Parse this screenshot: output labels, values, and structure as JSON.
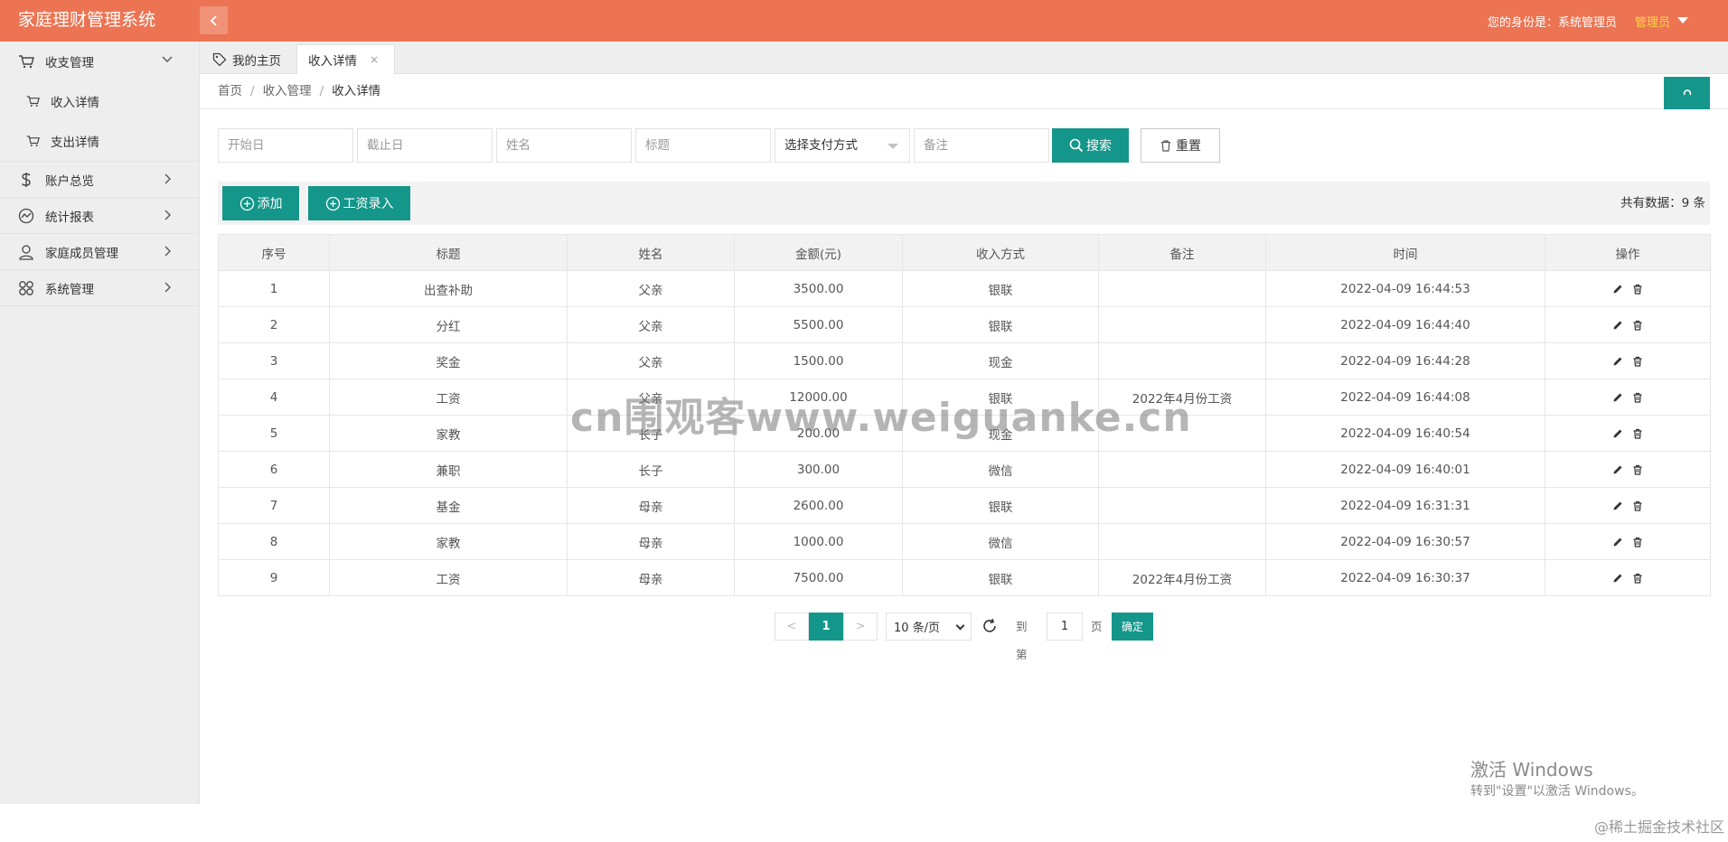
{
  "header": {
    "app_title": "家庭理财管理系统",
    "identity_text": "您的身份是：系统管理员",
    "user_label": "管理员"
  },
  "sidebar": {
    "groups": [
      {
        "label": "收支管理",
        "icon": "cart-icon",
        "expanded": true,
        "children": [
          {
            "label": "收入详情",
            "icon": "cart-icon"
          },
          {
            "label": "支出详情",
            "icon": "cart-icon"
          }
        ]
      },
      {
        "label": "账户总览",
        "icon": "dollar-icon"
      },
      {
        "label": "统计报表",
        "icon": "chart-icon"
      },
      {
        "label": "家庭成员管理",
        "icon": "user-icon"
      },
      {
        "label": "系统管理",
        "icon": "apps-icon"
      }
    ]
  },
  "tabs": [
    {
      "label": "我的主页",
      "icon": "tag-icon"
    },
    {
      "label": "收入详情",
      "close": "×",
      "active": true
    }
  ],
  "breadcrumb": [
    "首页",
    "收入管理",
    "收入详情"
  ],
  "breadcrumb_sep": "/",
  "search": {
    "start_placeholder": "开始日",
    "end_placeholder": "截止日",
    "name_placeholder": "姓名",
    "title_placeholder": "标题",
    "pay_method_value": "选择支付方式",
    "remark_placeholder": "备注",
    "search_label": "搜索",
    "reset_label": "重置"
  },
  "toolbar": {
    "add_label": "添加",
    "salary_label": "工资录入",
    "total_text": "共有数据：9 条"
  },
  "table": {
    "columns": [
      "序号",
      "标题",
      "姓名",
      "金额(元)",
      "收入方式",
      "备注",
      "时间",
      "操作"
    ],
    "rows": [
      [
        "1",
        "出查补助",
        "父亲",
        "3500.00",
        "银联",
        "",
        "2022-04-09 16:44:53"
      ],
      [
        "2",
        "分红",
        "父亲",
        "5500.00",
        "银联",
        "",
        "2022-04-09 16:44:40"
      ],
      [
        "3",
        "奖金",
        "父亲",
        "1500.00",
        "现金",
        "",
        "2022-04-09 16:44:28"
      ],
      [
        "4",
        "工资",
        "父亲",
        "12000.00",
        "银联",
        "2022年4月份工资",
        "2022-04-09 16:44:08"
      ],
      [
        "5",
        "家教",
        "长子",
        "200.00",
        "现金",
        "",
        "2022-04-09 16:40:54"
      ],
      [
        "6",
        "兼职",
        "长子",
        "300.00",
        "微信",
        "",
        "2022-04-09 16:40:01"
      ],
      [
        "7",
        "基金",
        "母亲",
        "2600.00",
        "银联",
        "",
        "2022-04-09 16:31:31"
      ],
      [
        "8",
        "家教",
        "母亲",
        "1000.00",
        "微信",
        "",
        "2022-04-09 16:30:57"
      ],
      [
        "9",
        "工资",
        "母亲",
        "7500.00",
        "银联",
        "2022年4月份工资",
        "2022-04-09 16:30:37"
      ]
    ]
  },
  "pagination": {
    "prev": "<",
    "current_page": "1",
    "next": ">",
    "page_size": "10 条/页",
    "goto_label": "到第",
    "goto_value": "1",
    "page_label": "页",
    "confirm_label": "确定"
  },
  "overlays": {
    "watermark": "cn围观客www.weiguanke.cn",
    "windows_title": "激活 Windows",
    "windows_sub": "转到\"设置\"以激活 Windows。",
    "corner_tag": "@稀土掘金技术社区"
  },
  "colors": {
    "header_bg": "#ec7453",
    "primary": "#15968a",
    "user_label": "#ffd44a"
  }
}
